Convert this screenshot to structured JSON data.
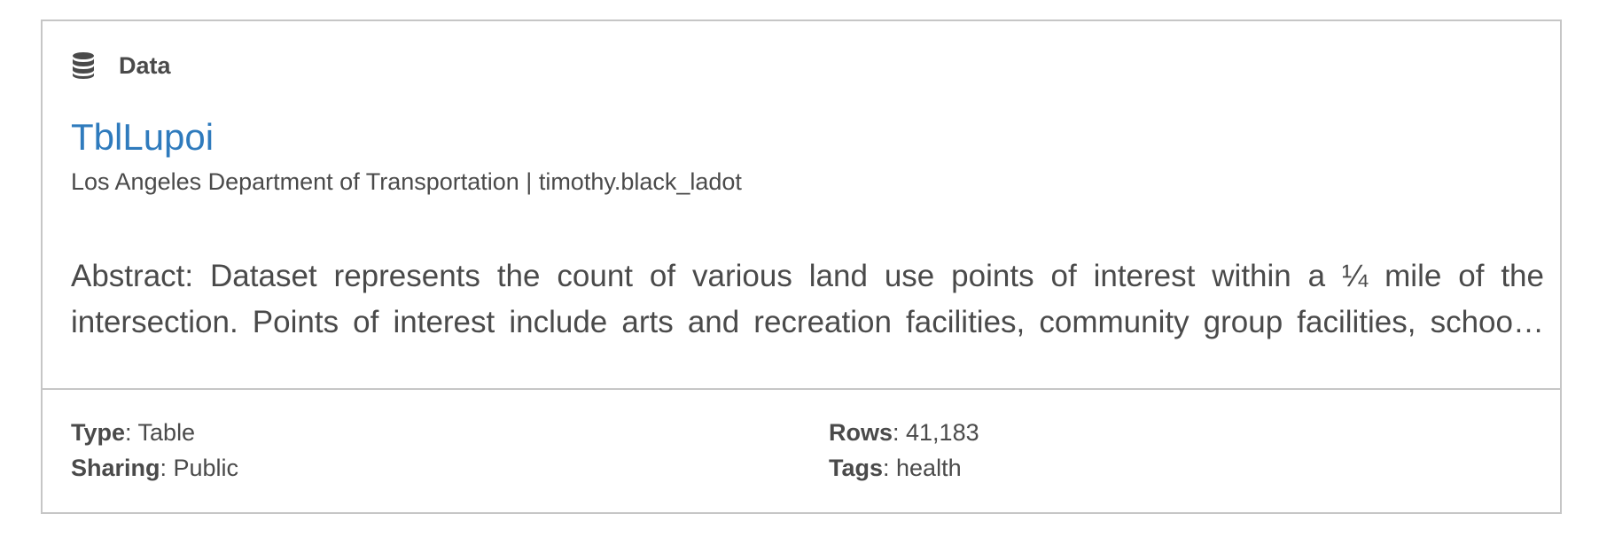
{
  "card": {
    "type_label": "Data",
    "type_icon": "database-icon",
    "title": "TblLupoi",
    "owner_line": "Los Angeles Department of Transportation | timothy.black_ladot",
    "abstract": "Abstract: Dataset represents the count of various land use points of interest within a ¼ mile of the intersection. Points of interest include arts and recreation facilities, community group facilities, schools, hospitals and other land uses.",
    "title_color": "#2f7bbd",
    "meta": {
      "type_key": "Type",
      "type_value": ": Table",
      "sharing_key": "Sharing",
      "sharing_value": ": Public",
      "rows_key": "Rows",
      "rows_value": ": 41,183",
      "tags_key": "Tags",
      "tags_value": ": health"
    }
  }
}
